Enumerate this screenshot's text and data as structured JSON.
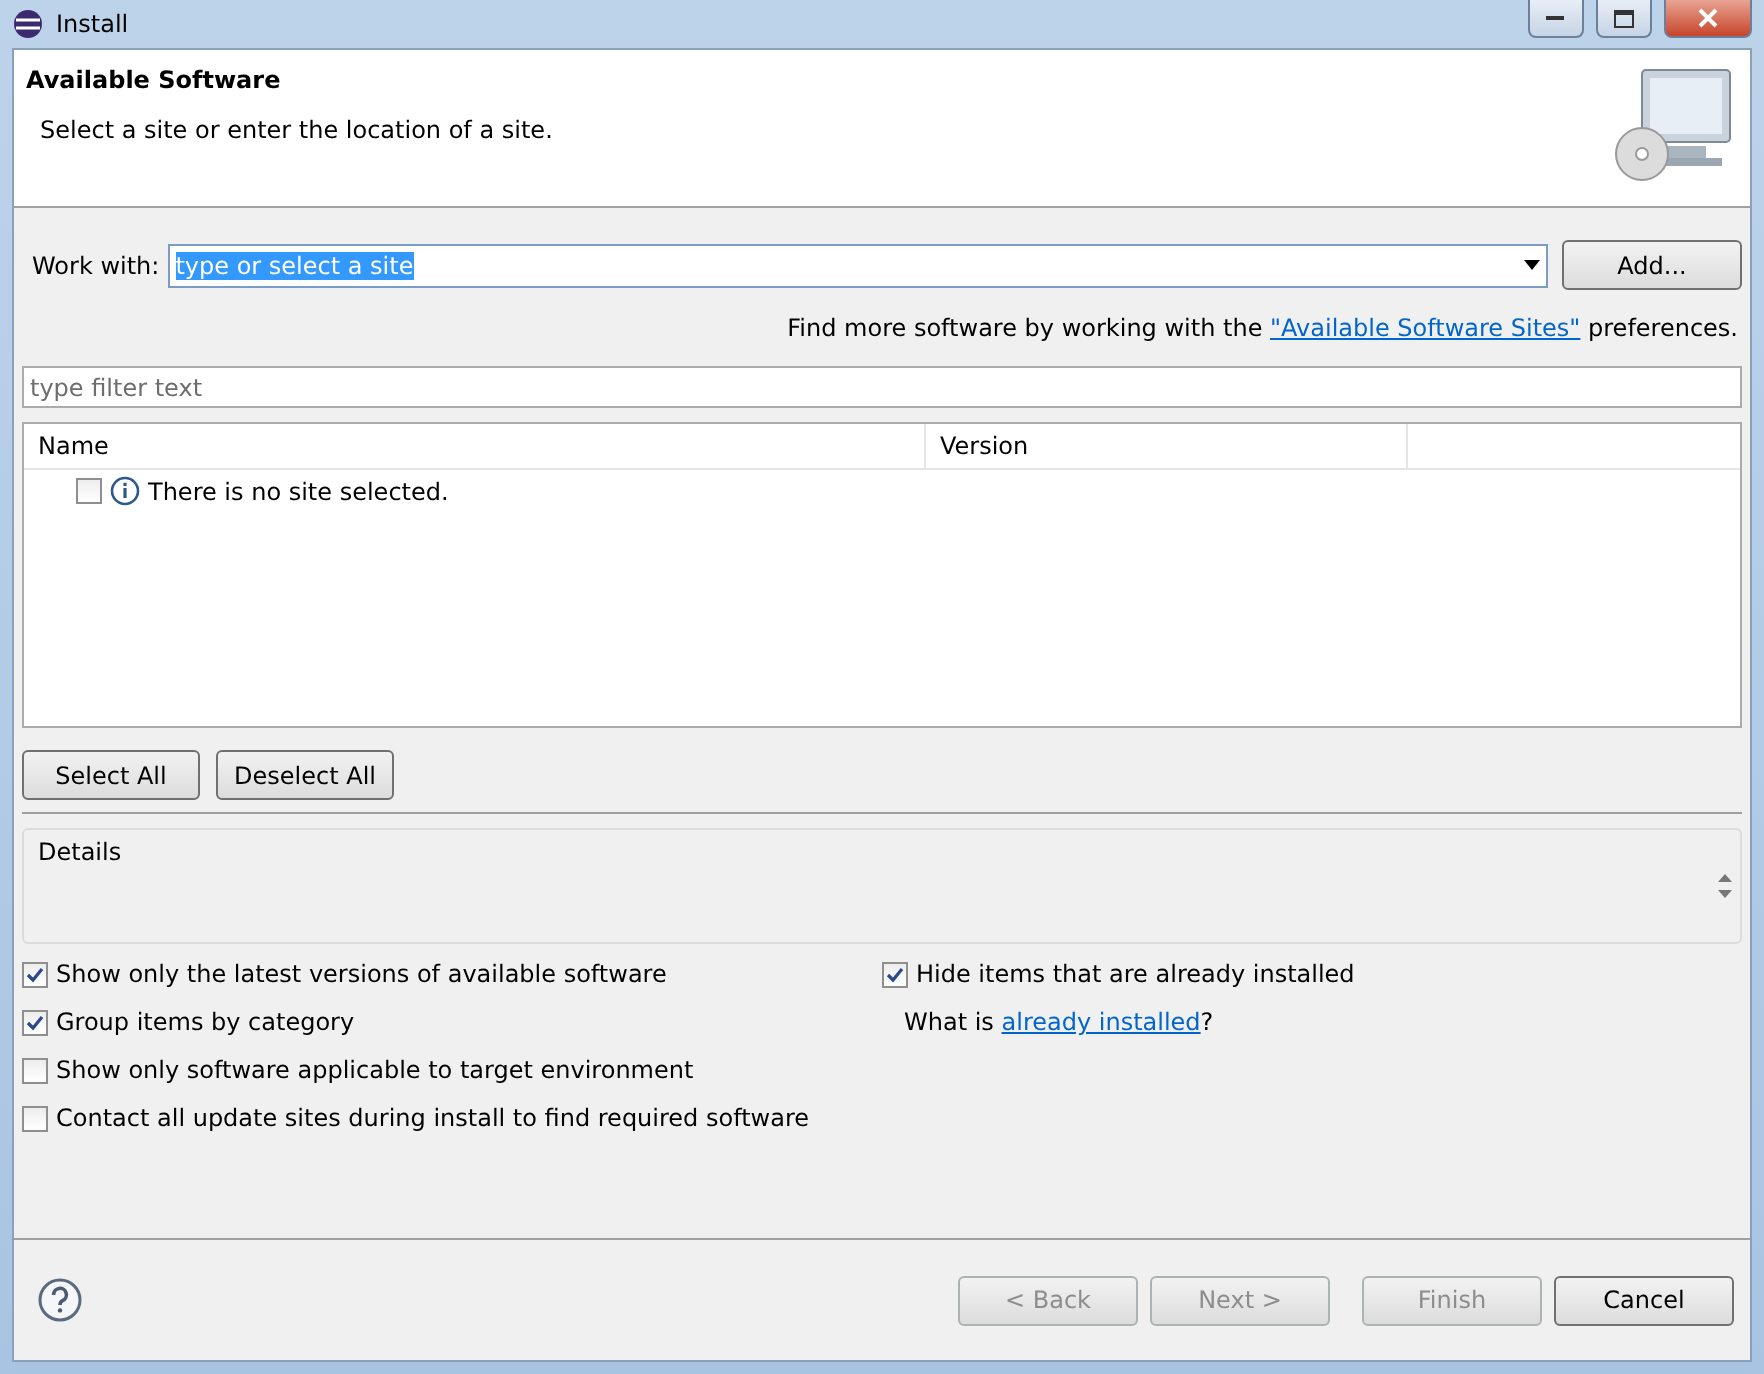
{
  "window": {
    "title": "Install"
  },
  "header": {
    "title": "Available Software",
    "description": "Select a site or enter the location of a site."
  },
  "work_with": {
    "label": "Work with:",
    "value": "type or select a site",
    "add_button": "Add..."
  },
  "hint": {
    "before": "Find more software by working with the ",
    "link": "\"Available Software Sites\"",
    "after": " preferences."
  },
  "filter": {
    "placeholder": "type filter text"
  },
  "table": {
    "columns": [
      "Name",
      "Version"
    ],
    "rows": [
      {
        "checked": false,
        "text": "There is no site selected."
      }
    ]
  },
  "selection_buttons": [
    "Select All",
    "Deselect All"
  ],
  "details": {
    "label": "Details"
  },
  "options": [
    {
      "label": "Show only the latest versions of available software",
      "checked": true
    },
    {
      "label": "Group items by category",
      "checked": true
    },
    {
      "label": "Show only software applicable to target environment",
      "checked": false
    },
    {
      "label": "Contact all update sites during install to find required software",
      "checked": false
    }
  ],
  "hide_installed": {
    "label": "Hide items that are already installed",
    "checked": true
  },
  "installed_hint": {
    "before": "What is ",
    "link": "already installed",
    "after": "?"
  },
  "footer_buttons": [
    {
      "label": "< Back",
      "disabled": true
    },
    {
      "label": "Next >",
      "disabled": true
    },
    {
      "label": "Finish",
      "disabled": true
    },
    {
      "label": "Cancel",
      "disabled": false
    }
  ]
}
